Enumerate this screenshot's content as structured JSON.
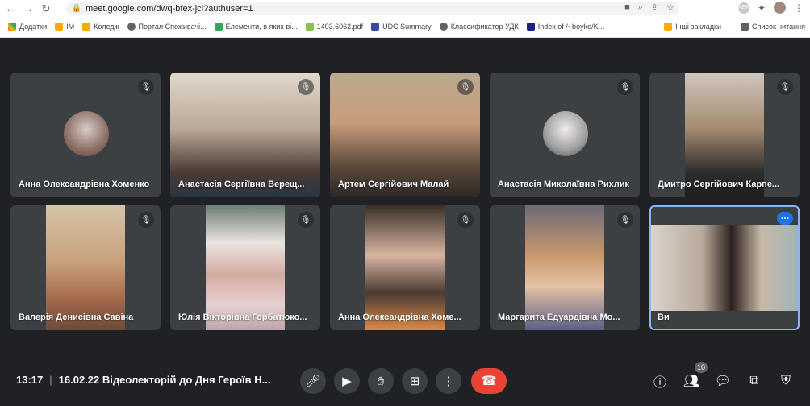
{
  "browser": {
    "url": "meet.google.com/dwq-bfex-jci?authuser=1",
    "bookmarks": [
      "Додатки",
      "IM",
      "Коледж",
      "Портал Споживачі...",
      "Елементи, в яких ві...",
      "1403.6062.pdf",
      "UDC Summary",
      "Классификатор УДК",
      "Index of /~boyko/K..."
    ],
    "bookmarks_right": [
      "Інші закладки",
      "Список читання"
    ],
    "extension_label": "ABP"
  },
  "participants": [
    {
      "name": "Анна Олександрівна Хоменко",
      "muted_icon": "mic-off-icon"
    },
    {
      "name": "Анастасія Сергіївна Верещ...",
      "muted_icon": "mic-off-icon"
    },
    {
      "name": "Артем Сергійович Малай",
      "muted_icon": "mic-off-icon"
    },
    {
      "name": "Анастасія Миколаївна Рихлик",
      "muted_icon": "mic-off-icon"
    },
    {
      "name": "Дмитро Сергійович Карпе...",
      "muted_icon": "mic-off-icon"
    },
    {
      "name": "Валерія Денисівна Савіна",
      "muted_icon": "mic-off-icon"
    },
    {
      "name": "Юлія Вікторівна Горбатюко...",
      "muted_icon": "mic-off-icon"
    },
    {
      "name": "Анна Олександрівна Хоме...",
      "muted_icon": "mic-off-icon"
    },
    {
      "name": "Маргарита Едуардівна Мо...",
      "muted_icon": "mic-off-icon"
    },
    {
      "name": "Ви",
      "muted_icon": "more-icon"
    }
  ],
  "meeting": {
    "time": "13:17",
    "title": "16.02.22 Відеолекторій до Дня Героїв Н...",
    "participant_count": "10"
  },
  "colors": {
    "leave": "#ea4335",
    "active_border": "#8ab4f8",
    "tile": "#3c4043",
    "background": "#202124"
  }
}
